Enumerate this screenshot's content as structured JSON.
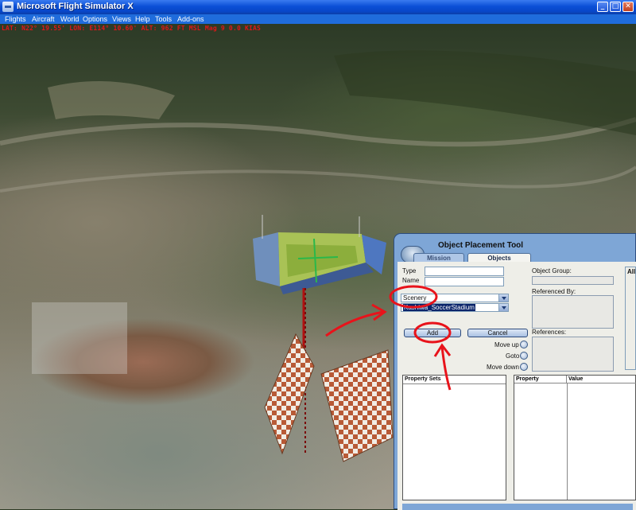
{
  "window": {
    "title": "Microsoft Flight Simulator X",
    "controls": {
      "minimize": "_",
      "maximize": "□",
      "close": "✕"
    }
  },
  "menu": {
    "items": [
      "Flights",
      "Aircraft",
      "World",
      "Options",
      "Views",
      "Help",
      "Tools",
      "Add-ons"
    ]
  },
  "hud": {
    "text": "LAT: N22° 19.55'  LON: E114° 10.60'  ALT: 962 FT  MSL   Mag 9  0.0 KIAS"
  },
  "panel": {
    "title": "Object Placement Tool",
    "tabs": {
      "mission": "Mission",
      "objects": "Objects"
    },
    "type_label": "Type",
    "name_label": "Name",
    "type_value": "",
    "name_value": "",
    "category_select": "Scenery",
    "object_select": "Kashiwa_SoccerStadium",
    "add_button": "Add",
    "cancel_button": "Cancel",
    "move_up": "Move up",
    "goto": "Goto",
    "move_down": "Move down",
    "object_group_label": "Object Group:",
    "referenced_by_label": "Referenced By:",
    "references_label": "References:",
    "all_label": "All",
    "property_sets_header": "Property Sets",
    "property_header": "Property",
    "value_header": "Value"
  },
  "colors": {
    "titlebar": "#0a4fd6",
    "menubar": "#1f6cdc",
    "panel_frame": "#7ea6d6",
    "annotation_red": "#e8131b",
    "hud_red": "#e01818"
  }
}
